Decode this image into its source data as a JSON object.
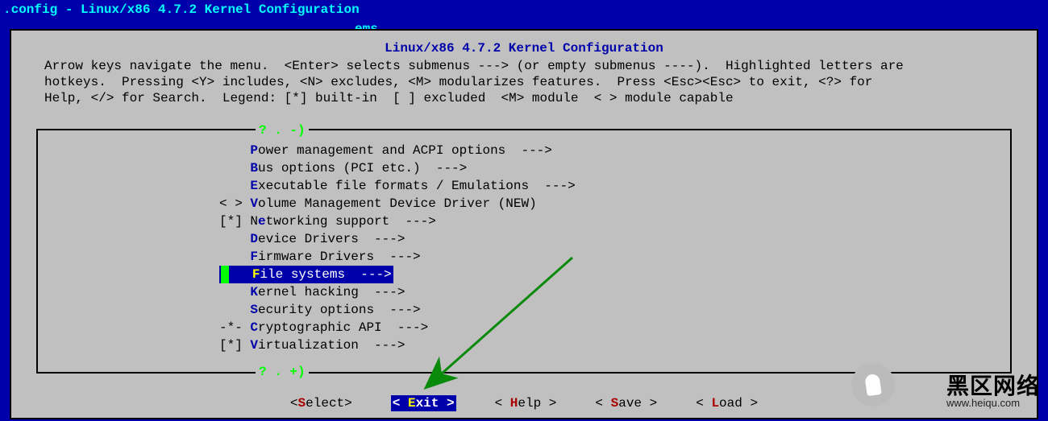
{
  "title_bar": ".config - Linux/x86 4.7.2 Kernel Configuration",
  "ems_label": "ems",
  "dialog_title": "Linux/x86 4.7.2 Kernel Configuration",
  "help_text": "Arrow keys navigate the menu.  <Enter> selects submenus ---> (or empty submenus ----).  Highlighted letters are\nhotkeys.  Pressing <Y> includes, <N> excludes, <M> modularizes features.  Press <Esc><Esc> to exit, <?> for\nHelp, </> for Search.  Legend: [*] built-in  [ ] excluded  <M> module  < > module capable",
  "scroll_up": "? . -)",
  "scroll_down": "? . +)",
  "menu": [
    {
      "prefix": "    ",
      "hot": "P",
      "rest": "ower management and ACPI options  --->"
    },
    {
      "prefix": "    ",
      "hot": "B",
      "rest": "us options (PCI etc.)  --->"
    },
    {
      "prefix": "    ",
      "hot": "E",
      "rest": "xecutable file formats / Emulations  --->"
    },
    {
      "prefix": "< > ",
      "hot": "V",
      "rest": "olume Management Device Driver (NEW)"
    },
    {
      "prefix": "[*] ",
      "hot_pos": 1,
      "pre": "N",
      "hot": "e",
      "rest": "tworking support  --->"
    },
    {
      "prefix": "    ",
      "hot": "D",
      "rest": "evice Drivers  --->"
    },
    {
      "prefix": "    ",
      "hot": "F",
      "rest": "irmware Drivers  --->"
    },
    {
      "prefix": "    ",
      "hot": "F",
      "rest": "ile systems  --->",
      "selected": true
    },
    {
      "prefix": "    ",
      "hot": "K",
      "rest": "ernel hacking  --->"
    },
    {
      "prefix": "    ",
      "hot": "S",
      "rest": "ecurity options  --->"
    },
    {
      "prefix": "-*- ",
      "hot": "C",
      "rest": "ryptographic API  --->"
    },
    {
      "prefix": "[*] ",
      "hot": "V",
      "rest": "irtualization  --->"
    }
  ],
  "buttons": [
    {
      "open": "<",
      "hot": "S",
      "rest": "elect>",
      "selected": false
    },
    {
      "open": "< ",
      "hot": "E",
      "rest": "xit >",
      "selected": true
    },
    {
      "open": "< ",
      "hot": "H",
      "rest": "elp >",
      "selected": false
    },
    {
      "open": "< ",
      "hot": "S",
      "rest": "ave >",
      "selected": false
    },
    {
      "open": "< ",
      "hot": "L",
      "rest": "oad >",
      "selected": false
    }
  ],
  "watermark": {
    "cn": "黑区网络",
    "url": "www.heiqu.com"
  }
}
